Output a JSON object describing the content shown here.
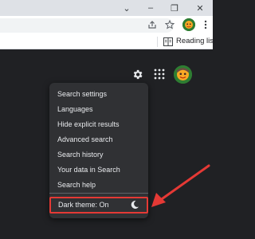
{
  "browser": {
    "window_controls": {
      "chevron": "⌄",
      "minimize": "–",
      "restore": "❐",
      "close": "✕"
    },
    "toolbar_icons": [
      "share-icon",
      "star-icon",
      "profile-avatar",
      "more-vert-icon"
    ],
    "bookmarks_bar": {
      "reading_list_label": "Reading list"
    }
  },
  "page": {
    "header_icons": [
      "settings-gear-icon",
      "apps-grid-icon",
      "account-avatar"
    ]
  },
  "settings_menu": {
    "items": [
      {
        "label": "Search settings"
      },
      {
        "label": "Languages"
      },
      {
        "label": "Hide explicit results"
      },
      {
        "label": "Advanced search"
      },
      {
        "label": "Search history"
      },
      {
        "label": "Your data in Search"
      },
      {
        "label": "Search help"
      }
    ],
    "dark_theme": {
      "label": "Dark theme: On",
      "icon": "moon-icon"
    }
  },
  "annotation": {
    "color": "#e53935",
    "target": "dark-theme-item"
  },
  "colors": {
    "page_bg": "#202124",
    "menu_bg": "#303134",
    "menu_text": "#e8eaed",
    "highlight": "#e53935"
  }
}
